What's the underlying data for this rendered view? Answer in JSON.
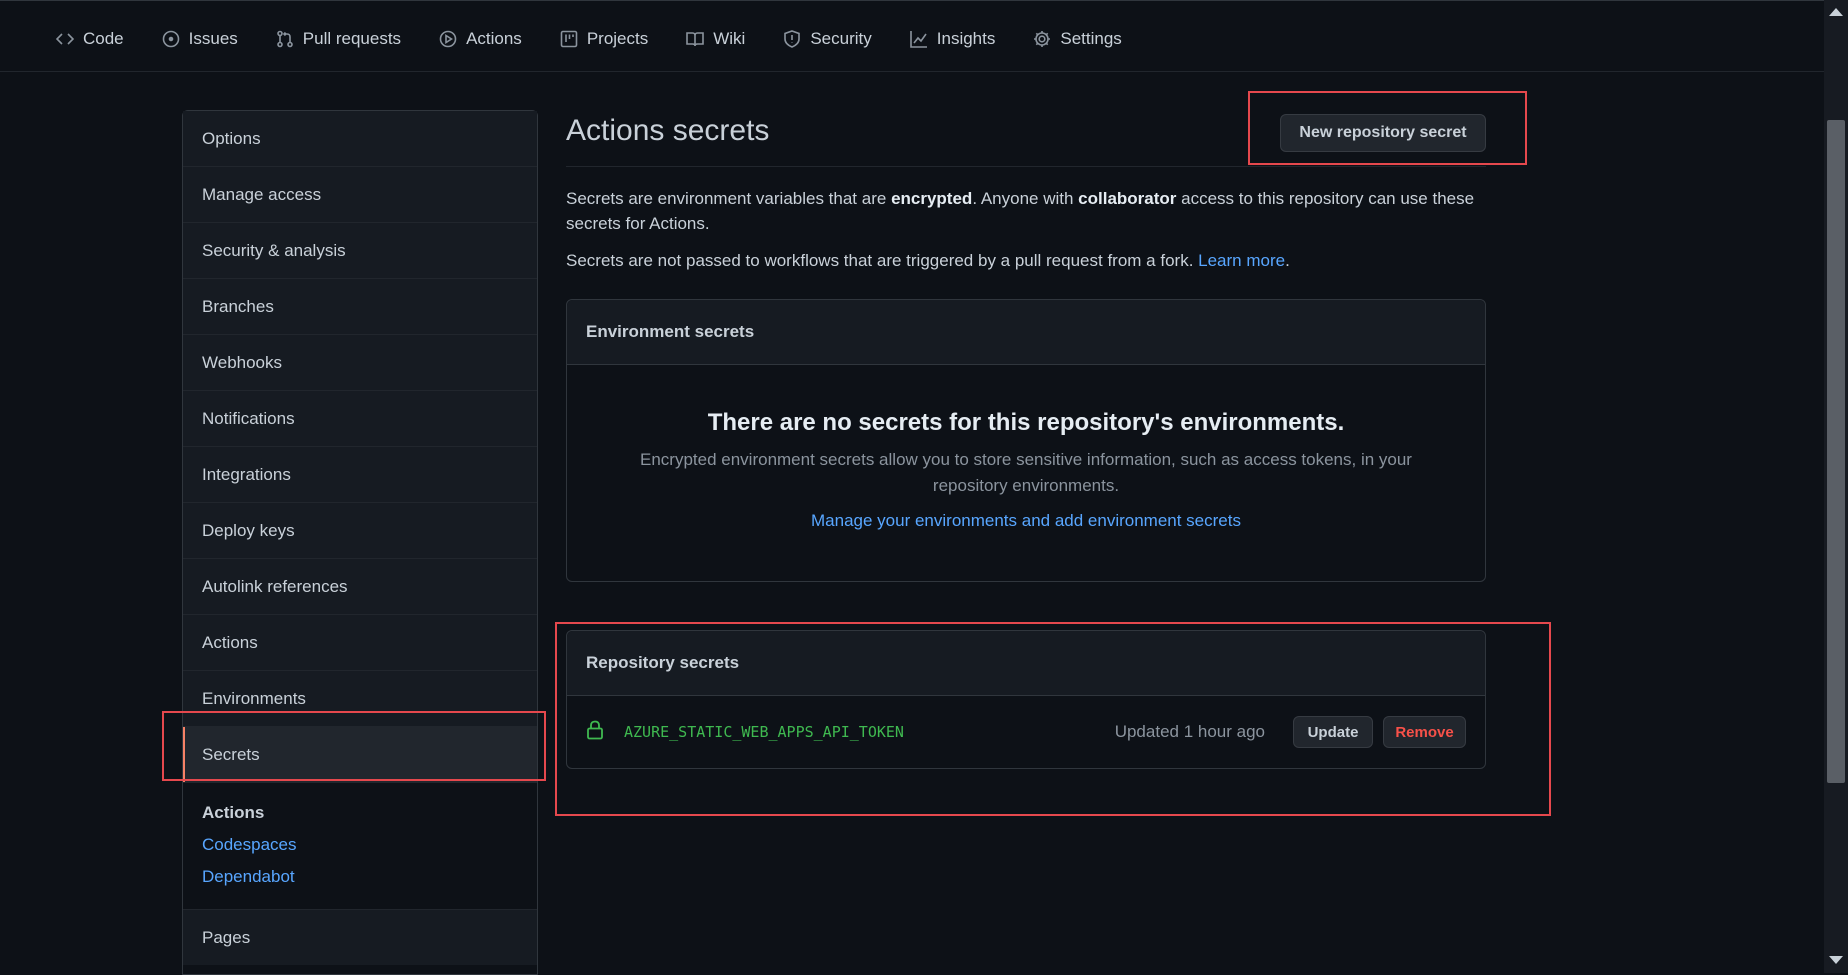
{
  "nav": {
    "tabs": [
      {
        "label": "Code",
        "icon": "code-icon"
      },
      {
        "label": "Issues",
        "icon": "issue-icon"
      },
      {
        "label": "Pull requests",
        "icon": "pull-request-icon"
      },
      {
        "label": "Actions",
        "icon": "play-icon"
      },
      {
        "label": "Projects",
        "icon": "project-icon"
      },
      {
        "label": "Wiki",
        "icon": "book-icon"
      },
      {
        "label": "Security",
        "icon": "shield-icon"
      },
      {
        "label": "Insights",
        "icon": "graph-icon"
      },
      {
        "label": "Settings",
        "icon": "gear-icon"
      }
    ]
  },
  "sidebar": {
    "items": [
      "Options",
      "Manage access",
      "Security & analysis",
      "Branches",
      "Webhooks",
      "Notifications",
      "Integrations",
      "Deploy keys",
      "Autolink references",
      "Actions",
      "Environments",
      "Secrets"
    ],
    "active_item": "Secrets",
    "sub_heading": "Actions",
    "sub_links": [
      "Codespaces",
      "Dependabot"
    ],
    "pages": "Pages"
  },
  "main": {
    "title": "Actions secrets",
    "new_secret_button": "New repository secret",
    "desc_part1": "Secrets are environment variables that are ",
    "desc_bold1": "encrypted",
    "desc_part2": ". Anyone with ",
    "desc_bold2": "collaborator",
    "desc_part3": " access to this repository can use these secrets for Actions.",
    "desc2_text": "Secrets are not passed to workflows that are triggered by a pull request from a fork. ",
    "learn_more": "Learn more",
    "desc2_end": ".",
    "env_secrets": {
      "header": "Environment secrets",
      "blank_title": "There are no secrets for this repository's environments.",
      "blank_desc": "Encrypted environment secrets allow you to store sensitive information, such as access tokens, in your repository environments.",
      "blank_link": "Manage your environments and add environment secrets"
    },
    "repo_secrets": {
      "header": "Repository secrets",
      "secret_name": "AZURE_STATIC_WEB_APPS_API_TOKEN",
      "updated": "Updated 1 hour ago",
      "update_label": "Update",
      "remove_label": "Remove"
    }
  },
  "colors": {
    "background": "#0d1117",
    "link": "#58a6ff",
    "secret_green": "#3fb950",
    "danger": "#f85149",
    "highlight": "#e5484d"
  }
}
